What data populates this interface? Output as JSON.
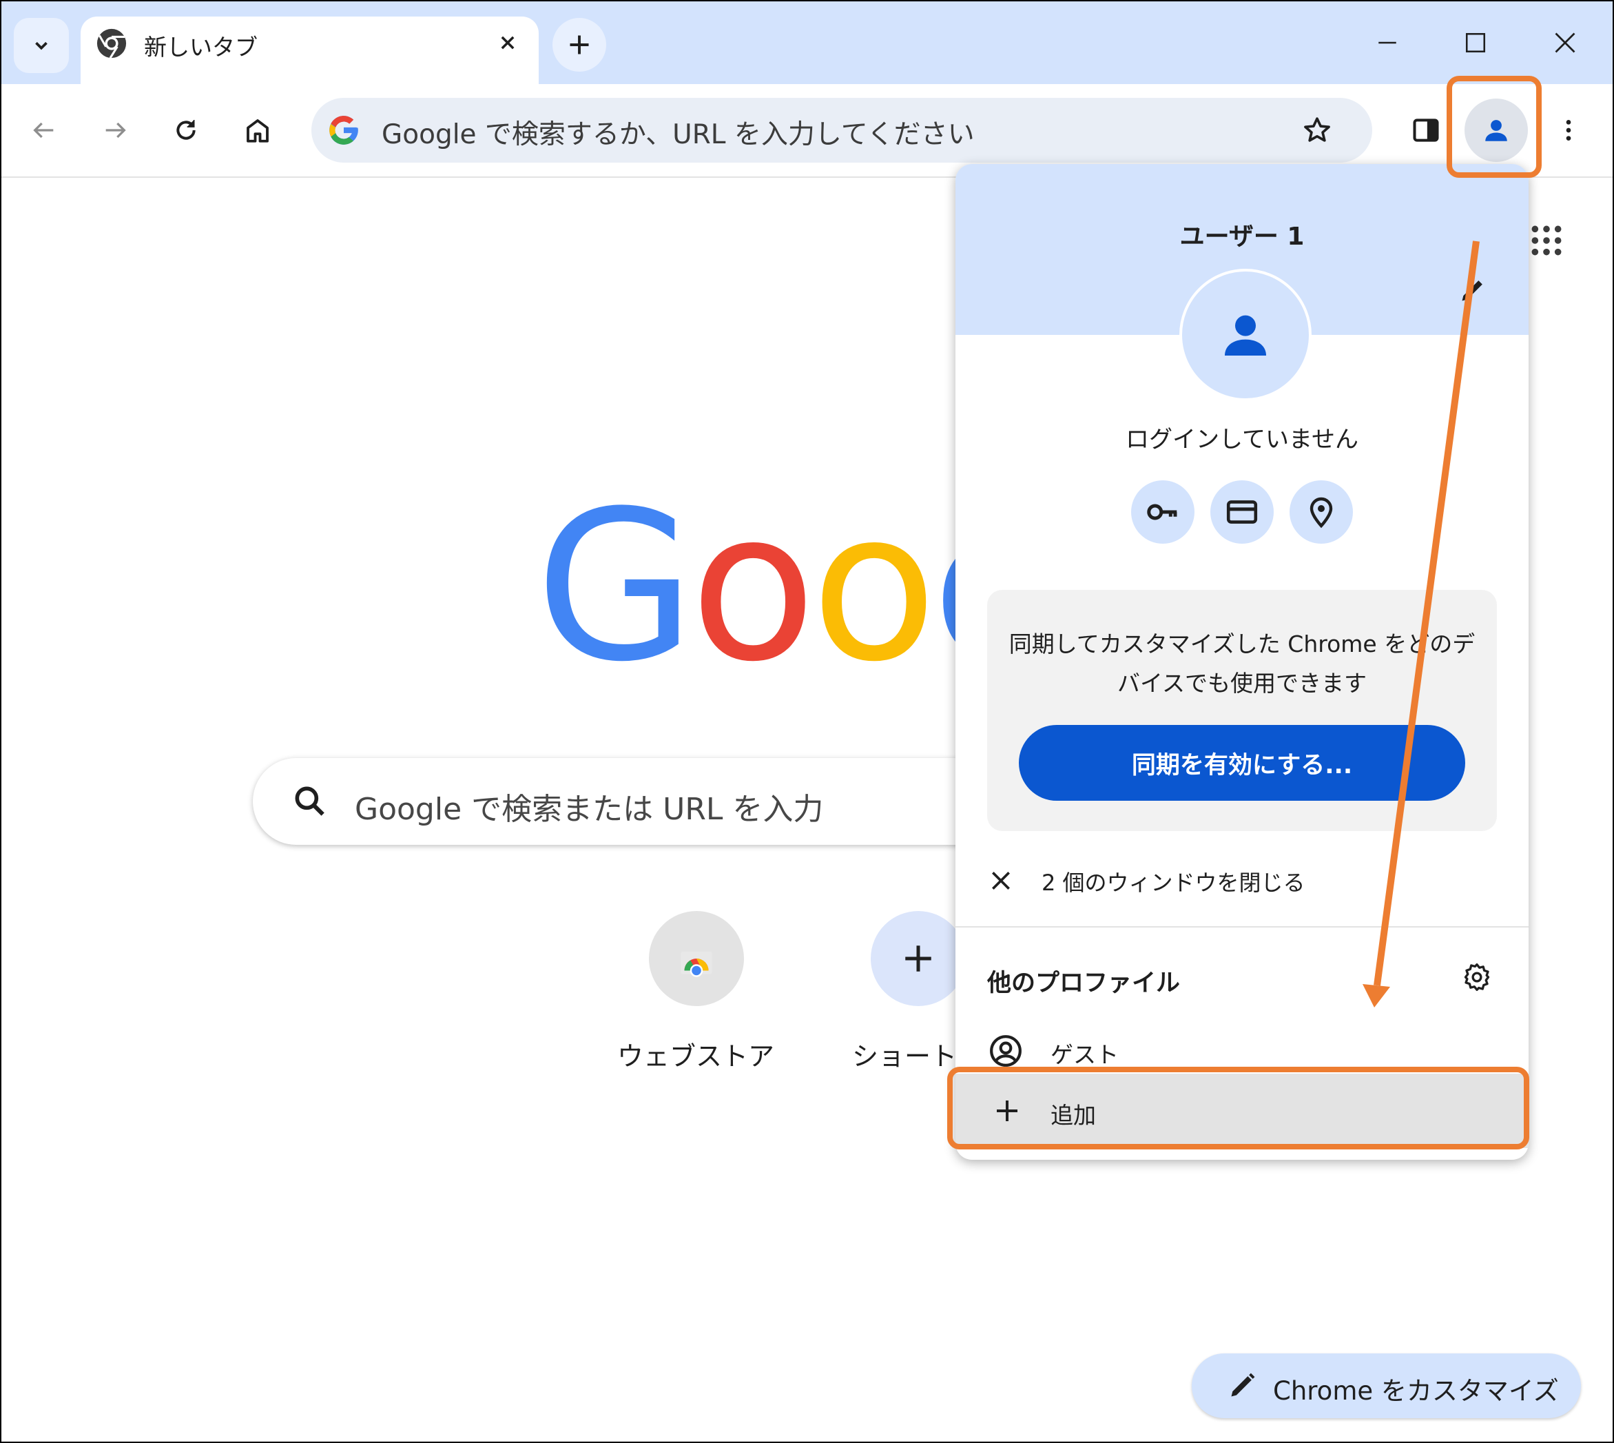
{
  "tab": {
    "title": "新しいタブ"
  },
  "omnibox": {
    "placeholder": "Google で検索するか、URL を入力してください"
  },
  "ntp": {
    "logo_letters": [
      "G",
      "o",
      "o",
      "g"
    ],
    "logo_colors": [
      "#4285f4",
      "#ea4335",
      "#fbbc05",
      "#4285f4"
    ],
    "search_placeholder": "Google で検索または URL を入力",
    "shortcuts": [
      {
        "label": "ウェブストア",
        "icon": "chrome-web-store-icon"
      },
      {
        "label": "ショートカ",
        "icon": "plus-icon"
      }
    ],
    "customize_label": "Chrome をカスタマイズ"
  },
  "profile_popup": {
    "name": "ユーザー 1",
    "status": "ログインしていません",
    "quick_actions": [
      "key-icon",
      "card-icon",
      "location-pin-icon"
    ],
    "sync_message": "同期してカスタマイズした Chrome をどのデバイスでも使用できます",
    "sync_button": "同期を有効にする...",
    "close_windows": "2 個のウィンドウを閉じる",
    "other_profiles_title": "他のプロファイル",
    "guest_label": "ゲスト",
    "add_label": "追加"
  },
  "colors": {
    "tabstrip": "#d3e3fd",
    "accent_blue": "#0b57d0",
    "annotation_orange": "#ed7d31"
  }
}
